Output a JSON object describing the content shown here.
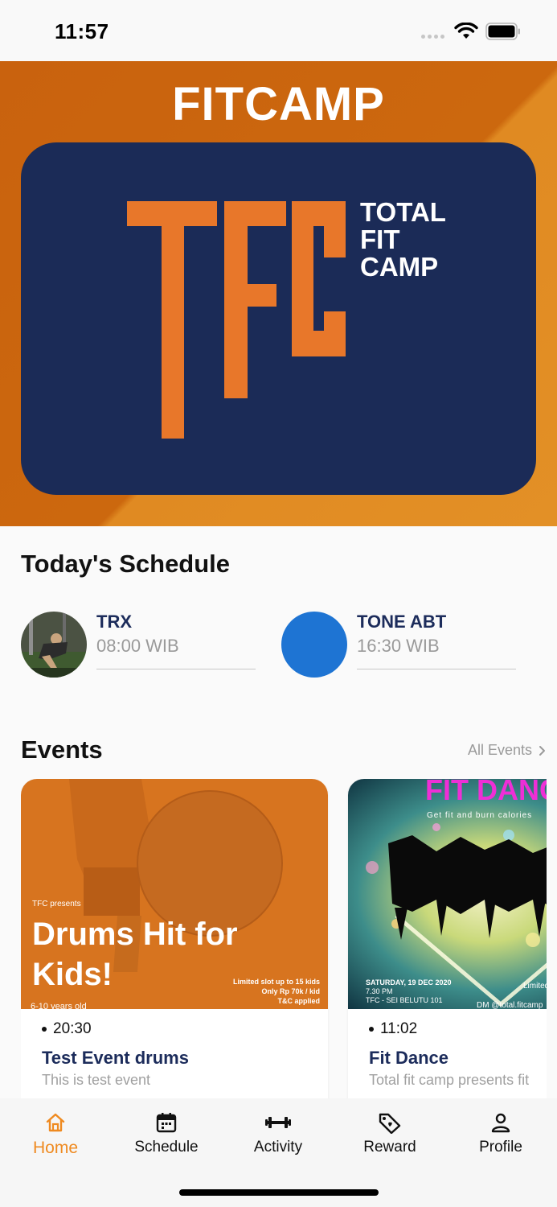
{
  "status_bar": {
    "time": "11:57"
  },
  "hero": {
    "title": "FITCAMP",
    "logo_letters": "TFC",
    "logo_lines": [
      "TOTAL",
      "FIT",
      "CAMP"
    ]
  },
  "schedule": {
    "title": "Today's Schedule",
    "items": [
      {
        "name": "TRX",
        "time": "08:00 WIB",
        "avatar": "photo"
      },
      {
        "name": "TONE ABT",
        "time": "16:30 WIB",
        "avatar_color": "#1e74d3"
      }
    ]
  },
  "events": {
    "title": "Events",
    "all_label": "All Events",
    "items": [
      {
        "time": "20:30",
        "title": "Test Event drums",
        "description": "This is test event",
        "poster": {
          "kicker": "TFC presents",
          "headline_1": "Drums Hit for",
          "headline_2": "Kids!",
          "age": "6-10 years old",
          "note_1": "Limited slot up to 15 kids",
          "note_2": "Only Rp 70k / kid",
          "note_3": "T&C applied"
        }
      },
      {
        "time": "11:02",
        "title": "Fit Dance",
        "description": "Total fit camp presents fit",
        "poster": {
          "headline": "FIT DANCE",
          "tagline": "Get fit and burn calories",
          "date": "SATURDAY, 19 DEC 2020",
          "hour": "7.30 PM",
          "venue": "TFC - SEI BELUTU 101",
          "limit": "Limited",
          "contact": "DM @total.fitcamp"
        }
      }
    ]
  },
  "nav": {
    "items": [
      {
        "label": "Home",
        "icon": "home-icon",
        "active": true
      },
      {
        "label": "Schedule",
        "icon": "calendar-icon"
      },
      {
        "label": "Activity",
        "icon": "dumbbell-icon"
      },
      {
        "label": "Reward",
        "icon": "tag-icon"
      },
      {
        "label": "Profile",
        "icon": "person-icon"
      }
    ],
    "active_color": "#ef8a20"
  },
  "colors": {
    "brand_orange": "#e8772a",
    "navy": "#1b2b57",
    "title_navy": "#1c2c5b"
  }
}
